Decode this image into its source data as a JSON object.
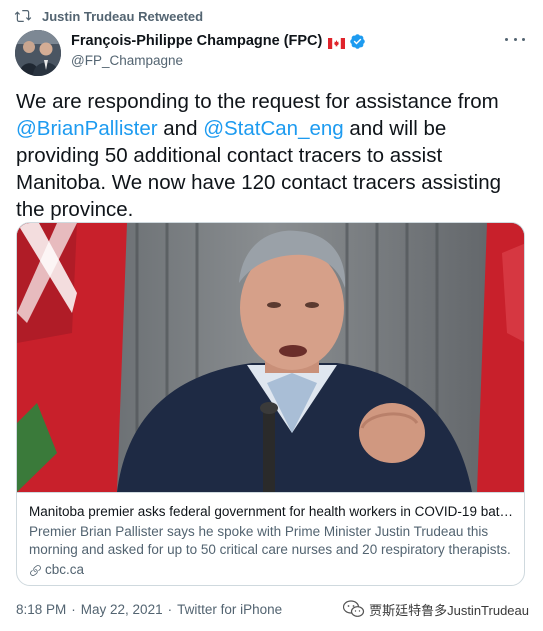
{
  "retweet": {
    "label": "Justin Trudeau Retweeted",
    "icon": "retweet-icon"
  },
  "author": {
    "name": "François-Philippe Champagne (FPC)",
    "handle": "@FP_Champagne",
    "flag_icon": "canada-flag-icon",
    "verified_icon": "verified-badge-icon"
  },
  "more_icon": "more-options-icon",
  "tweet": {
    "text_1": "We are responding to the request for assistance from ",
    "mention_1": "@BrianPallister",
    "text_2": " and ",
    "mention_2": "@StatCan_eng",
    "text_3": " and will be providing 50 additional contact tracers to assist Manitoba. We now have 120 contact tracers assisting the province."
  },
  "card": {
    "headline": "Manitoba premier asks federal government for health workers in COVID-19 batt...",
    "description": "Premier Brian Pallister says he spoke with Prime Minister Justin Trudeau this morning and asked for up to 50 critical care nurses and 20 respiratory therapists.",
    "domain": "cbc.ca",
    "link_icon": "link-icon"
  },
  "footer": {
    "time": "8:18 PM",
    "separator": "·",
    "date": "May 22, 2021",
    "separator_2": "·",
    "source": "Twitter for iPhone"
  },
  "watermark": {
    "text": "贾斯廷特鲁多JustinTrudeau",
    "icon": "wechat-icon"
  },
  "colors": {
    "link_blue": "#1d9bf0",
    "secondary_text": "#536471",
    "border": "#cfd9de"
  }
}
